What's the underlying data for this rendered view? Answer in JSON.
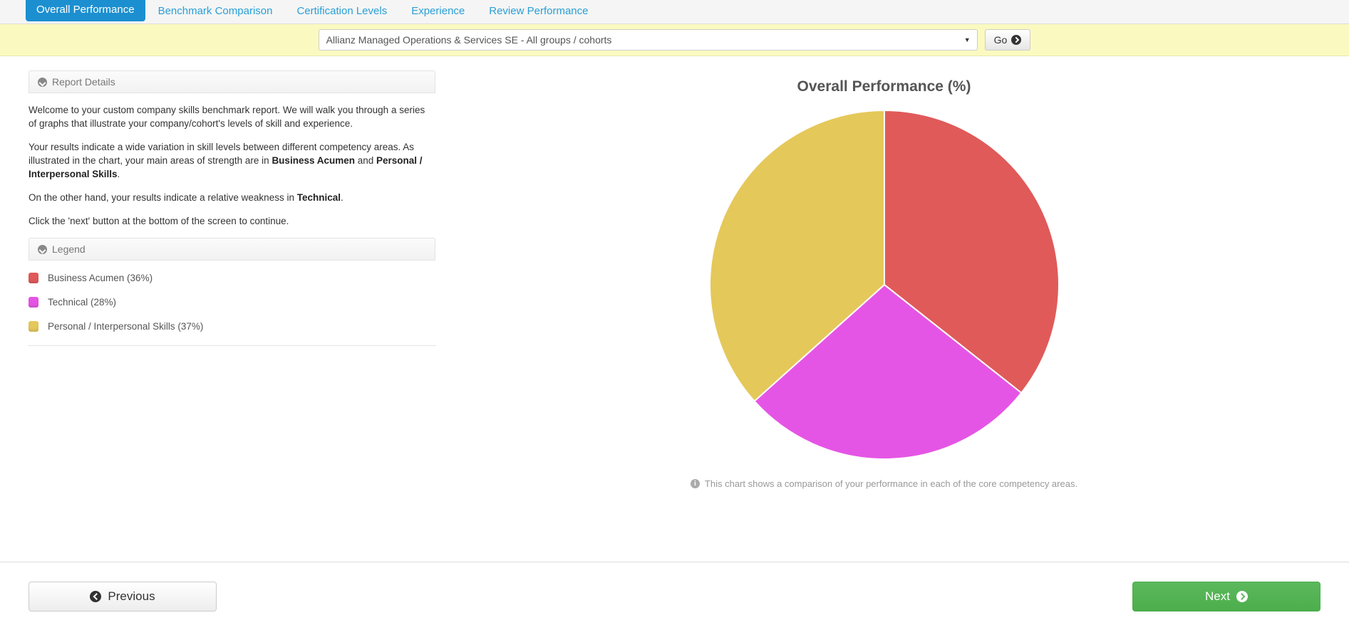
{
  "tabs": [
    {
      "label": "Overall Performance",
      "active": true
    },
    {
      "label": "Benchmark Comparison",
      "active": false
    },
    {
      "label": "Certification Levels",
      "active": false
    },
    {
      "label": "Experience",
      "active": false
    },
    {
      "label": "Review Performance",
      "active": false
    }
  ],
  "selector": {
    "value": "Allianz Managed Operations & Services SE - All groups / cohorts",
    "caret": "▼",
    "go_label": "Go"
  },
  "report_details": {
    "title": "Report Details",
    "paragraphs": [
      {
        "parts": [
          {
            "text": "Welcome to your custom company skills benchmark report. We will walk you through a series of graphs that illustrate your company/cohort's levels of skill and experience.",
            "bold": false
          }
        ]
      },
      {
        "parts": [
          {
            "text": "Your results indicate a wide variation in skill levels between different competency areas. As illustrated in the chart, your main areas of strength are in ",
            "bold": false
          },
          {
            "text": "Business Acumen",
            "bold": true
          },
          {
            "text": " and ",
            "bold": false
          },
          {
            "text": "Personal / Interpersonal Skills",
            "bold": true
          },
          {
            "text": ".",
            "bold": false
          }
        ]
      },
      {
        "parts": [
          {
            "text": "On the other hand, your results indicate a relative weakness in ",
            "bold": false
          },
          {
            "text": "Technical",
            "bold": true
          },
          {
            "text": ".",
            "bold": false
          }
        ]
      },
      {
        "parts": [
          {
            "text": "Click the 'next' button at the bottom of the screen to continue.",
            "bold": false
          }
        ]
      }
    ]
  },
  "legend": {
    "title": "Legend",
    "items": [
      {
        "label": "Business Acumen (36%)",
        "color": "#e05a5a"
      },
      {
        "label": "Technical (28%)",
        "color": "#e555e5"
      },
      {
        "label": "Personal / Interpersonal Skills (37%)",
        "color": "#e5c85a"
      }
    ]
  },
  "chart_caption": "This chart shows a comparison of your performance in each of the core competency areas.",
  "footer": {
    "previous_label": "Previous",
    "next_label": "Next"
  },
  "chart_data": {
    "type": "pie",
    "title": "Overall Performance (%)",
    "categories": [
      "Business Acumen",
      "Technical",
      "Personal / Interpersonal Skills"
    ],
    "values": [
      36,
      28,
      37
    ],
    "colors": [
      "#e05a5a",
      "#e555e5",
      "#e5c85a"
    ],
    "unit": "%",
    "start_angle": 0,
    "direction": "clockwise",
    "legend_position": "left-panel",
    "slice_border_color": "#ffffff",
    "slice_border_width": 2,
    "radius_px": 245
  }
}
